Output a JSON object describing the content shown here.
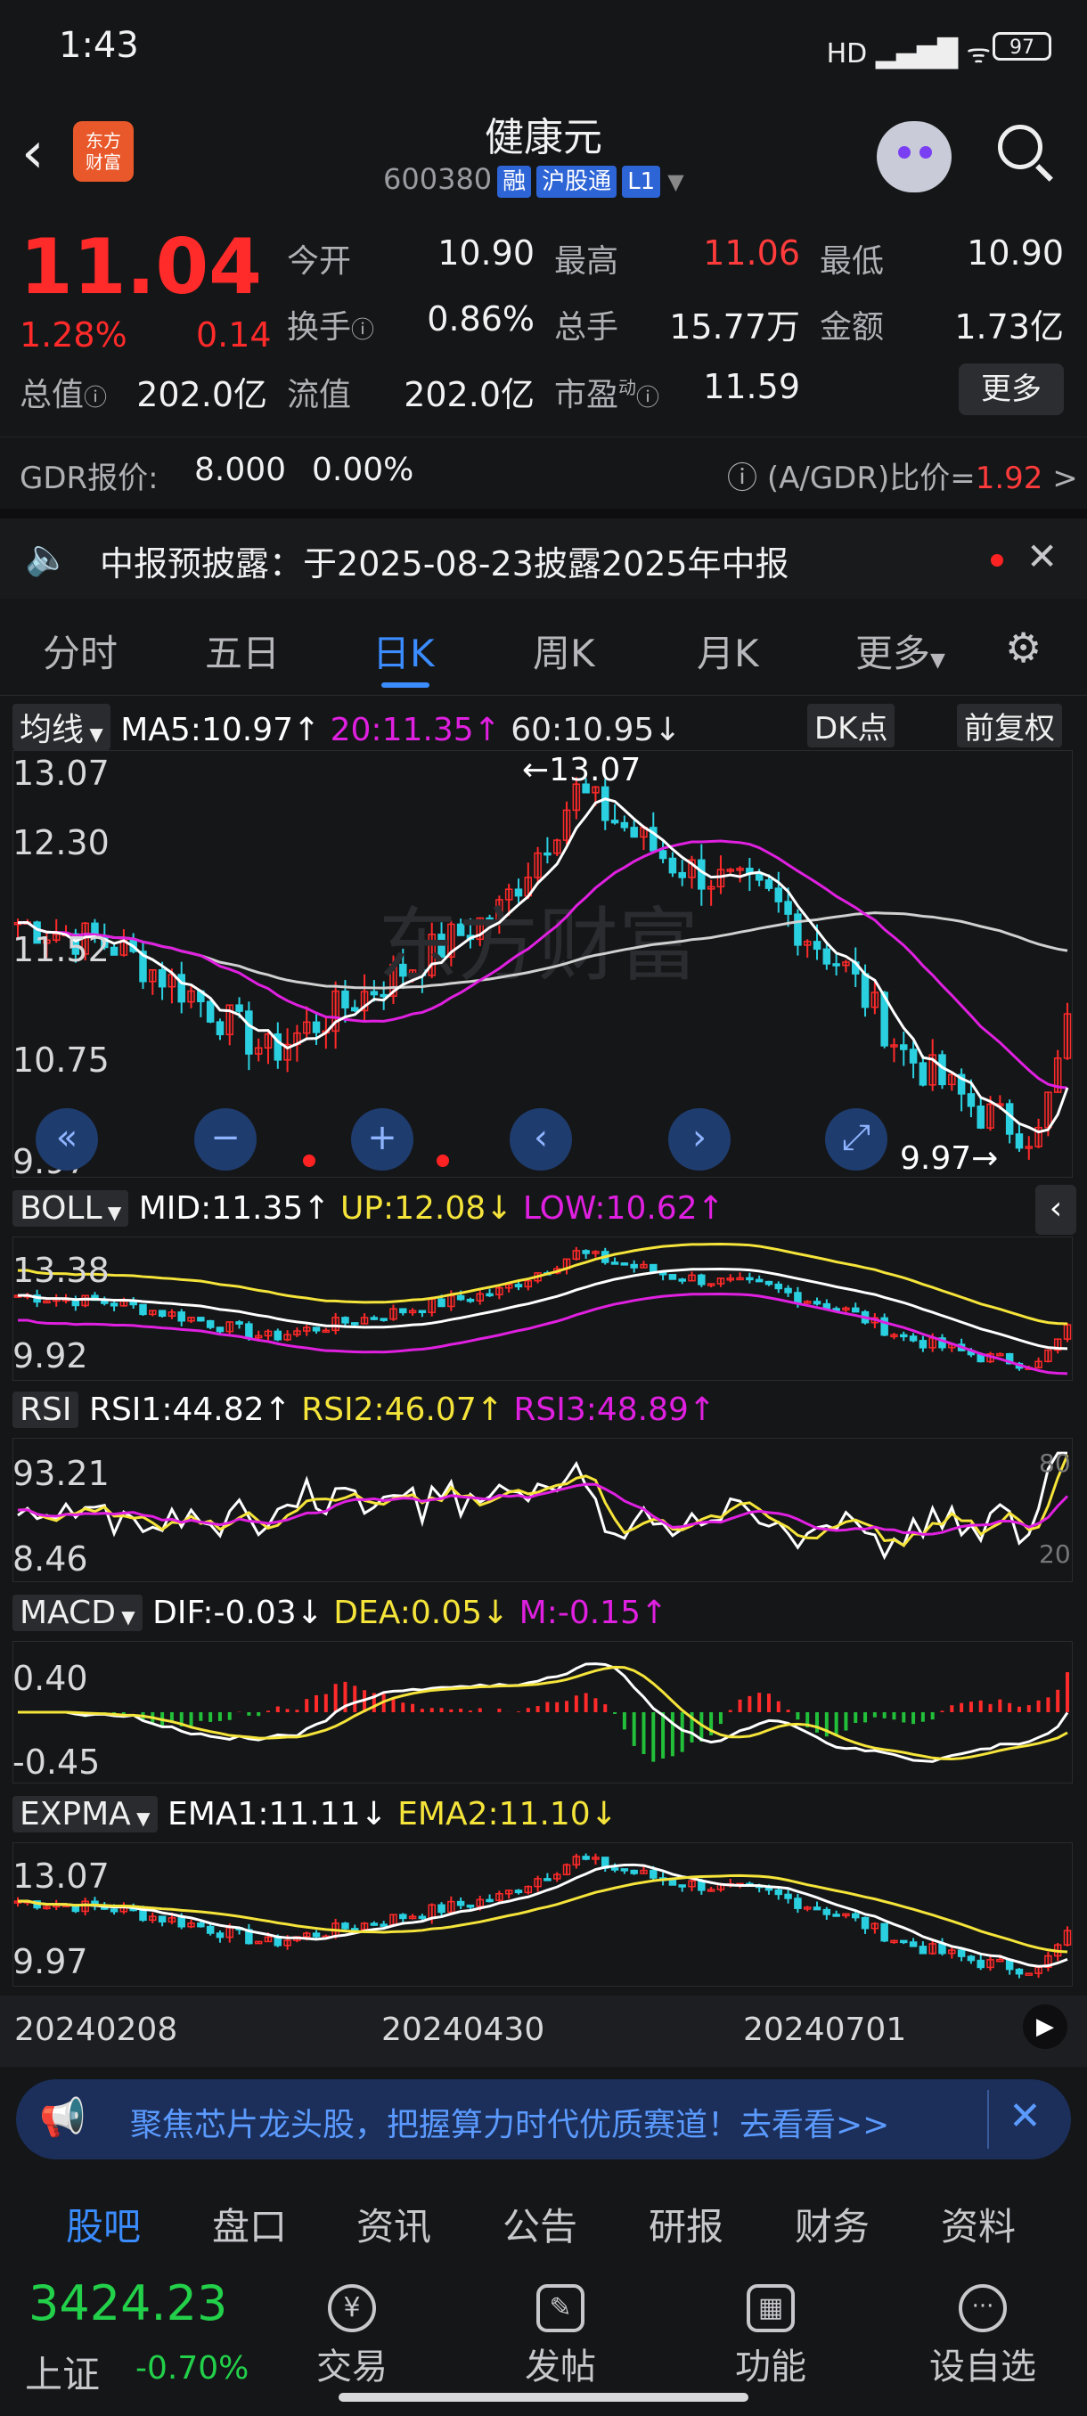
{
  "status": {
    "time": "1:43",
    "signal": "HD ▂▄▆█ ᯤ",
    "battery": "97"
  },
  "header": {
    "title": "健康元",
    "code": "600380",
    "tags": [
      "融",
      "沪股通",
      "L1"
    ],
    "logo": "东方\n财富"
  },
  "quote": {
    "price": "11.04",
    "change_pct": "1.28%",
    "change": "0.14",
    "fields": [
      {
        "label": "今开",
        "value": "10.90"
      },
      {
        "label": "最高",
        "value": "11.06"
      },
      {
        "label": "最低",
        "value": "10.90"
      },
      {
        "label": "换手",
        "value": "0.86%"
      },
      {
        "label": "总手",
        "value": "15.77万"
      },
      {
        "label": "金额",
        "value": "1.73亿"
      },
      {
        "label": "总值",
        "value": "202.0亿"
      },
      {
        "label": "流值",
        "value": "202.0亿"
      },
      {
        "label": "市盈",
        "value": "11.59"
      }
    ],
    "pe_sup": "动",
    "more": "更多"
  },
  "gdr": {
    "label": "GDR报价:",
    "price": "8.000",
    "pct": "0.00%",
    "ratio_label": "(A/GDR)比价=",
    "ratio": "1.92",
    "arrow": ">"
  },
  "notice": {
    "prefix": "中报预披露：",
    "text": "于2025-08-23披露2025年中报"
  },
  "tabs": [
    "分时",
    "五日",
    "日K",
    "周K",
    "月K",
    "更多"
  ],
  "chart": {
    "ma_label": "均线",
    "ma5": "MA5:10.97↑",
    "ma20": "20:11.35↑",
    "ma60": "60:10.95↓",
    "dk": "DK点",
    "fq": "前复权",
    "y": [
      "13.07",
      "12.30",
      "11.52",
      "10.75",
      "9.97"
    ],
    "high_ann": "←13.07",
    "low_ann": "9.97→",
    "watermark": "东方财富",
    "boll": {
      "name": "BOLL",
      "mid": "MID:11.35↑",
      "up": "UP:12.08↓",
      "low": "LOW:10.62↑",
      "y": [
        "13.38",
        "9.92"
      ]
    },
    "rsi": {
      "name": "RSI",
      "r1": "RSI1:44.82↑",
      "r2": "RSI2:46.07↑",
      "r3": "RSI3:48.89↑",
      "y": [
        "93.21",
        "8.46"
      ],
      "lv": [
        "80",
        "20"
      ]
    },
    "macd": {
      "name": "MACD",
      "dif": "DIF:-0.03↓",
      "dea": "DEA:0.05↓",
      "m": "M:-0.15↑",
      "y": [
        "0.40",
        "-0.45"
      ]
    },
    "expma": {
      "name": "EXPMA",
      "e1": "EMA1:11.11↓",
      "e2": "EMA2:11.10↓",
      "y": [
        "13.07",
        "9.97"
      ]
    },
    "dates": [
      "20240208",
      "20240430",
      "20240701"
    ]
  },
  "banner": {
    "text": "聚焦芯片龙头股，把握算力时代优质赛道！去看看>>"
  },
  "bottom_tabs": [
    "股吧",
    "盘口",
    "资讯",
    "公告",
    "研报",
    "财务",
    "资料"
  ],
  "footer": {
    "index_name": "上证",
    "index_value": "3424.23",
    "index_pct": "-0.70%",
    "actions": [
      "交易",
      "发帖",
      "功能",
      "设自选"
    ]
  },
  "colors": {
    "up": "#ff2a2a",
    "down": "#2ad0e0",
    "ma5": "#ffffff",
    "ma20": "#e020e0",
    "ma60": "#cccccc",
    "yellow": "#f5e43a",
    "accent": "#3a8cff"
  }
}
